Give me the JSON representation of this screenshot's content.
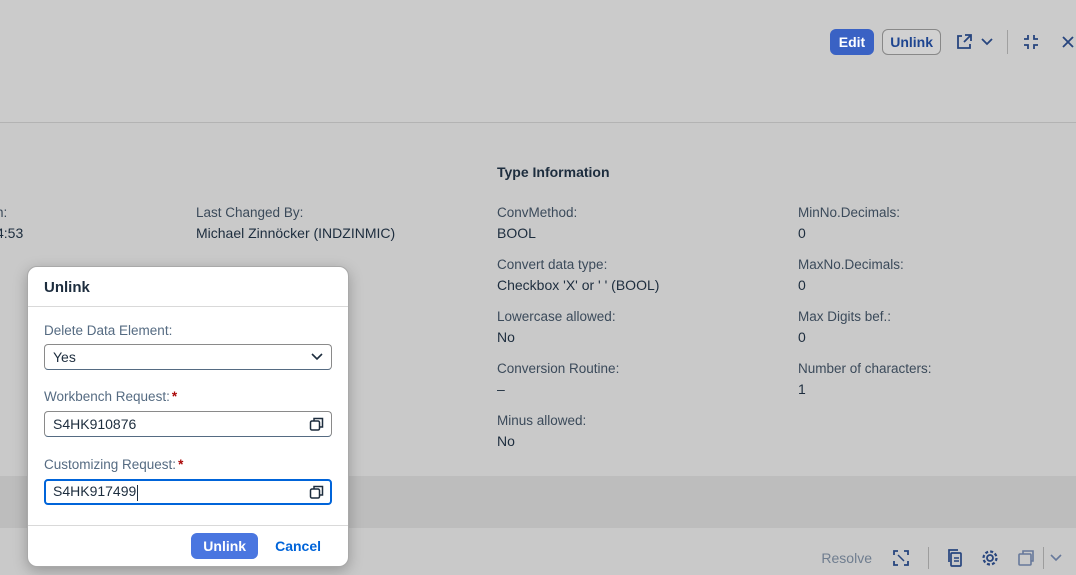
{
  "header": {
    "actions": {
      "edit_label": "Edit",
      "unlink_label": "Unlink"
    },
    "icons": [
      "share-icon",
      "chevron-down-icon",
      "exit-full-screen-icon",
      "close-icon"
    ]
  },
  "content": {
    "section_title": "Type Information",
    "left_partial": {
      "label": "n:",
      "value": "4:53"
    },
    "last_changed_by": {
      "label": "Last Changed By:",
      "value": "Michael Zinnöcker (INDZINMIC)"
    },
    "type_info_col1": [
      {
        "label": "ConvMethod:",
        "value": "BOOL"
      },
      {
        "label": "Convert data type:",
        "value": "Checkbox 'X' or ' ' (BOOL)"
      },
      {
        "label": "Lowercase allowed:",
        "value": "No"
      },
      {
        "label": "Conversion Routine:",
        "value": "–"
      },
      {
        "label": "Minus allowed:",
        "value": "No"
      }
    ],
    "type_info_col2": [
      {
        "label": "MinNo.Decimals:",
        "value": "0"
      },
      {
        "label": "MaxNo.Decimals:",
        "value": "0"
      },
      {
        "label": "Max Digits bef.:",
        "value": "0"
      },
      {
        "label": "Number of characters:",
        "value": "1"
      }
    ]
  },
  "footer": {
    "resolve_label": "Resolve",
    "icons": [
      "expand-icon",
      "copy-icon",
      "settings-icon",
      "export-icon",
      "chevron-down-icon"
    ]
  },
  "dialog": {
    "title": "Unlink",
    "delete_label": "Delete Data Element:",
    "delete_value": "Yes",
    "workbench_label": "Workbench Request:",
    "workbench_value": "S4HK910876",
    "customizing_label": "Customizing Request:",
    "customizing_value": "S4HK917499",
    "required_mark": "*",
    "unlink_button": "Unlink",
    "cancel_button": "Cancel"
  },
  "colors": {
    "accent": "#3a62c4",
    "link": "#0064d9",
    "required": "#aa0808",
    "overlay": "#c9c9c9"
  }
}
